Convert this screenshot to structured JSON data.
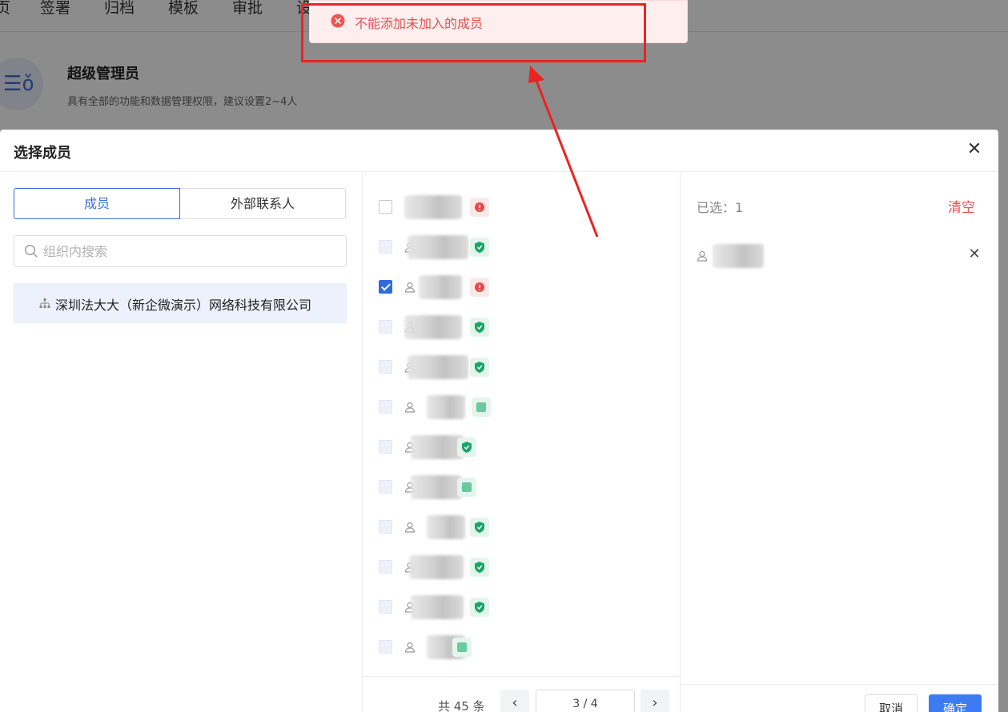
{
  "background": {
    "nav_items": [
      "页",
      "签署",
      "归档",
      "模板",
      "审批",
      "设"
    ],
    "role": {
      "icon_text": "☰ǒ",
      "title": "超级管理员",
      "description": "具有全部的功能和数据管理权限，建议设置2~4人"
    }
  },
  "toast": {
    "type": "error",
    "message": "不能添加未加入的成员"
  },
  "modal": {
    "title": "选择成员",
    "tabs": [
      {
        "label": "成员",
        "active": true
      },
      {
        "label": "外部联系人",
        "active": false
      }
    ],
    "search": {
      "placeholder": "组织内搜索",
      "value": ""
    },
    "org_tree": [
      {
        "label": "深圳法大大（新企微演示）网络科技有限公司",
        "selected": true
      }
    ],
    "members": [
      {
        "state": "unchecked",
        "badge": "red-alert"
      },
      {
        "state": "disabled",
        "badge": "green-shield"
      },
      {
        "state": "checked",
        "badge": "red-alert"
      },
      {
        "state": "disabled",
        "badge": "green-shield"
      },
      {
        "state": "disabled",
        "badge": "green-shield"
      },
      {
        "state": "disabled",
        "badge": "green-square"
      },
      {
        "state": "disabled",
        "badge": "green-shield"
      },
      {
        "state": "disabled",
        "badge": "green-square"
      },
      {
        "state": "disabled",
        "badge": "green-shield"
      },
      {
        "state": "disabled",
        "badge": "green-shield"
      },
      {
        "state": "disabled",
        "badge": "green-shield"
      },
      {
        "state": "disabled",
        "badge": "green-square"
      }
    ],
    "pagination": {
      "total_text": "共 45 条",
      "page_text": "3 / 4",
      "prev_icon": "chevron-left-icon",
      "next_icon": "chevron-right-icon"
    },
    "selected": {
      "count_label": "已选：1",
      "clear_label": "清空"
    },
    "buttons": {
      "cancel_label": "取消",
      "ok_label": "确定"
    }
  },
  "colors": {
    "primary": "#3d7bf0",
    "danger": "#e35454",
    "toast_bg": "#feeeee",
    "annotation": "#ee2222"
  }
}
